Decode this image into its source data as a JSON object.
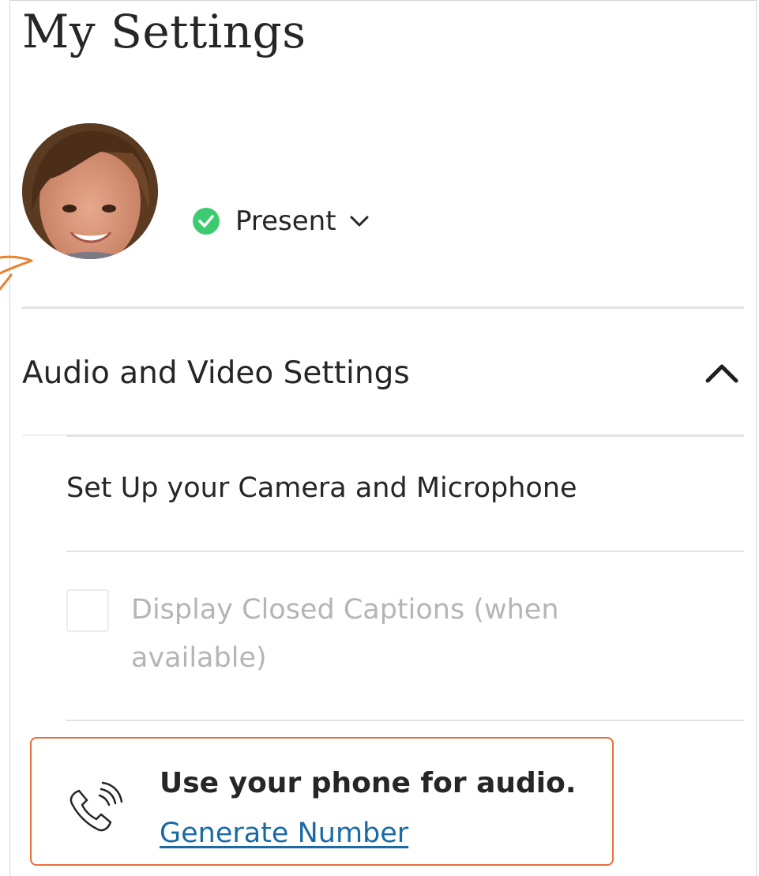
{
  "page": {
    "title": "My Settings"
  },
  "profile": {
    "status_label": "Present",
    "status_color": "#3ccb70"
  },
  "audio_video": {
    "section_title": "Audio and Video Settings",
    "setup_label": "Set Up your Camera and Microphone",
    "captions_label": "Display Closed Captions (when available)",
    "captions_checked": false,
    "captions_enabled": false
  },
  "phone": {
    "title": "Use your phone for audio.",
    "link_label": "Generate Number",
    "highlight_color": "#ea6e3c",
    "link_color": "#1a6aa6"
  },
  "icons": {
    "status": "check-circle-icon",
    "status_caret": "chevron-down-icon",
    "section_toggle": "chevron-up-icon",
    "phone": "phone-ringing-icon"
  }
}
